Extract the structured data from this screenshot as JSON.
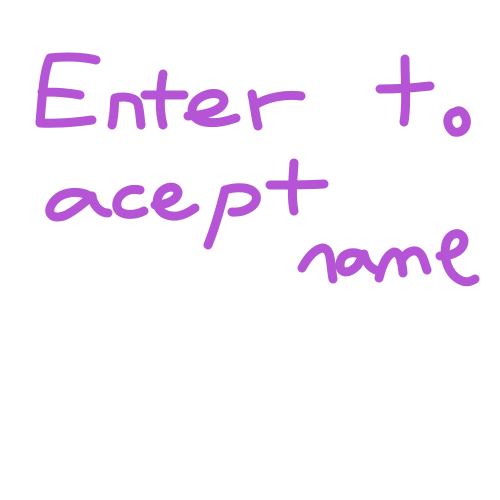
{
  "drawing": {
    "lines": [
      "Enter to",
      "acept",
      "name"
    ],
    "stroke_color": "#b555d6",
    "background_color": "#ffffff"
  }
}
